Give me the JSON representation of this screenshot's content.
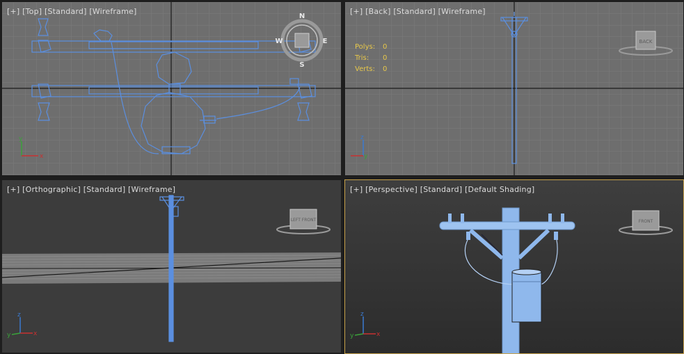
{
  "viewports": {
    "top": {
      "plus": "[+]",
      "view": "[Top]",
      "mode": "[Standard]",
      "shading": "[Wireframe]",
      "compass": {
        "n": "N",
        "s": "S",
        "e": "E",
        "w": "W"
      }
    },
    "back": {
      "plus": "[+]",
      "view": "[Back]",
      "mode": "[Standard]",
      "shading": "[Wireframe]",
      "viewcube_label": "BACK",
      "stats": {
        "polys_label": "Polys:",
        "polys": "0",
        "tris_label": "Tris:",
        "tris": "0",
        "verts_label": "Verts:",
        "verts": "0"
      }
    },
    "ortho": {
      "plus": "[+]",
      "view": "[Orthographic]",
      "mode": "[Standard]",
      "shading": "[Wireframe]",
      "viewcube_label": "LEFT FRONT"
    },
    "persp": {
      "plus": "[+]",
      "view": "[Perspective]",
      "mode": "[Standard]",
      "shading": "[Default Shading]",
      "viewcube_label": "FRONT"
    }
  },
  "axis": {
    "x": "x",
    "y": "y",
    "z": "z"
  },
  "colors": {
    "wire": "#5b8fe0",
    "shaded": "#8fb8ec",
    "active_border": "#c8a24a",
    "grid_bg": "#6e6e6e",
    "dark_bg": "#3c3c3c",
    "stats": "#e8c84a"
  }
}
